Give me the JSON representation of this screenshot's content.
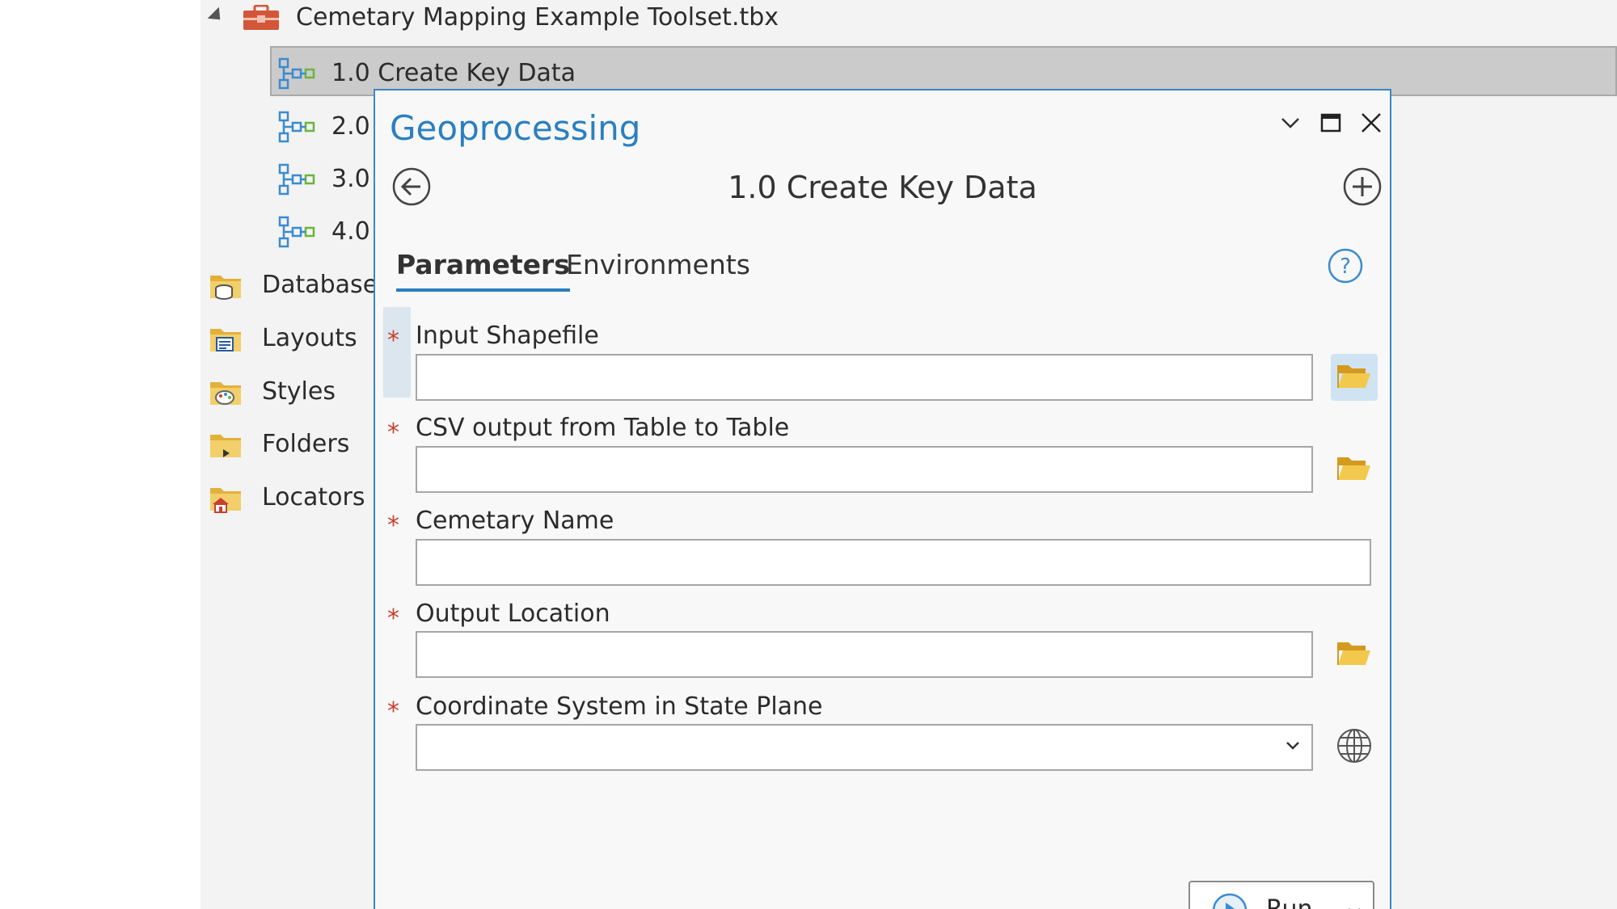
{
  "catalog": {
    "toolbox_label": "Cemetary Mapping Example Toolset.tbx",
    "tools": [
      {
        "label": "1.0 Create Key Data"
      },
      {
        "label": "2.0"
      },
      {
        "label": "3.0"
      },
      {
        "label": "4.0"
      }
    ],
    "folders": [
      {
        "label": "Databases",
        "icon": "database-folder-icon"
      },
      {
        "label": "Layouts",
        "icon": "layout-folder-icon"
      },
      {
        "label": "Styles",
        "icon": "style-folder-icon"
      },
      {
        "label": "Folders",
        "icon": "folder-connection-icon"
      },
      {
        "label": "Locators",
        "icon": "locator-folder-icon"
      }
    ]
  },
  "geoprocessing": {
    "window_title": "Geoprocessing",
    "tool_title": "1.0 Create Key Data",
    "tabs": [
      {
        "label": "Parameters"
      },
      {
        "label": "Environments"
      }
    ],
    "parameters": [
      {
        "label": "Input Shapefile",
        "required_mark": "*",
        "value": ""
      },
      {
        "label": "CSV output from Table to Table",
        "required_mark": "*",
        "value": ""
      },
      {
        "label": "Cemetary Name",
        "required_mark": "*",
        "value": ""
      },
      {
        "label": "Output Location",
        "required_mark": "*",
        "value": ""
      },
      {
        "label": "Coordinate System in State Plane",
        "required_mark": "*",
        "value": ""
      }
    ],
    "run_label": "Run"
  },
  "colors": {
    "accent": "#2a7fc0",
    "required": "#c8402f",
    "folder": "#e2b13c"
  }
}
